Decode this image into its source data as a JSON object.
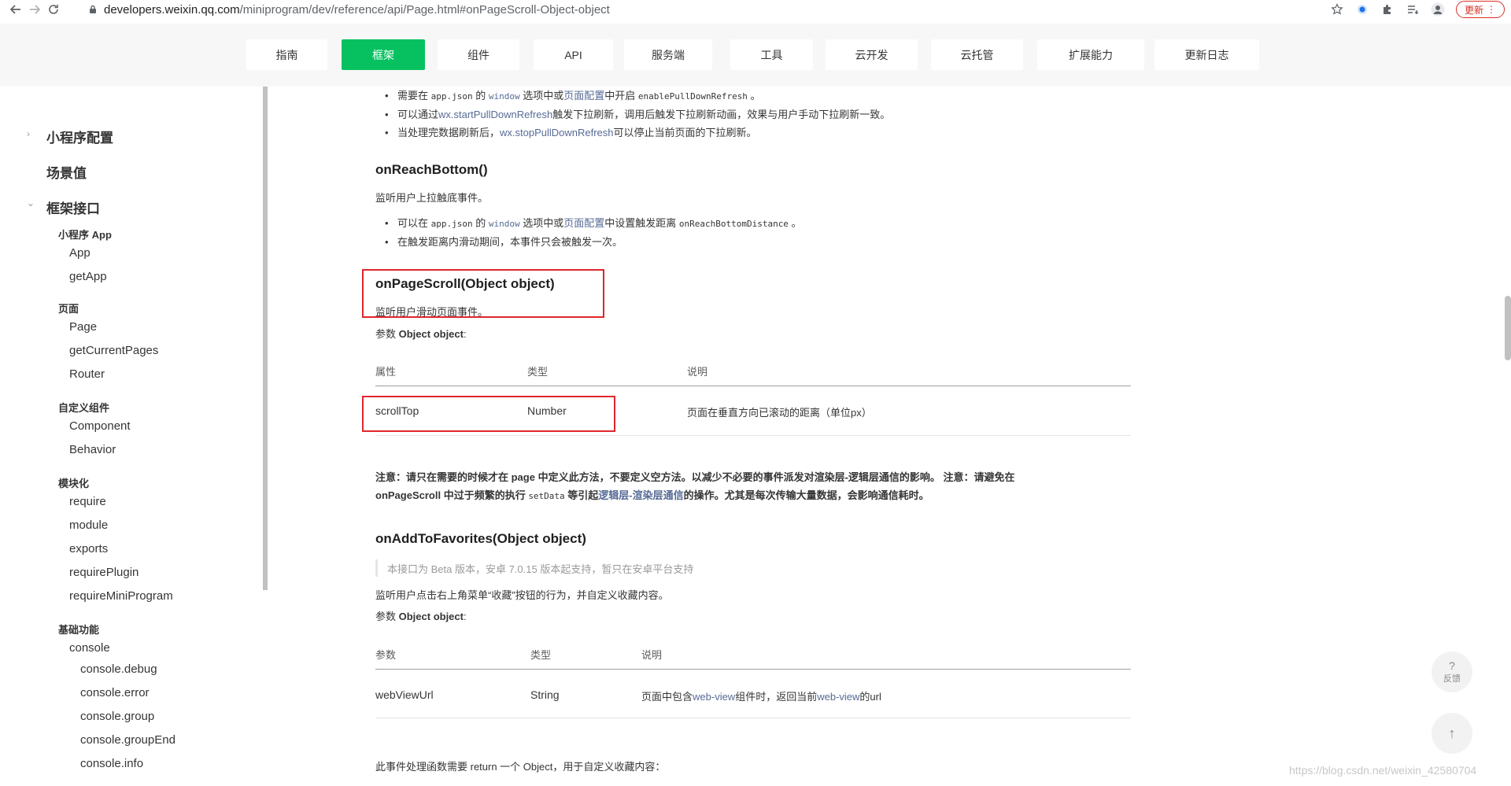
{
  "browser": {
    "url_host": "developers.weixin.qq.com",
    "url_path": "/miniprogram/dev/reference/api/Page.html#onPageScroll-Object-object",
    "update_label": "更新"
  },
  "topnav": {
    "tabs": [
      "指南",
      "框架",
      "组件",
      "API",
      "服务端",
      "工具",
      "云开发",
      "云托管",
      "扩展能力",
      "更新日志"
    ],
    "active_index": 1
  },
  "sidebar": {
    "item_config": "小程序配置",
    "item_scene": "场景值",
    "item_framework": "框架接口",
    "group_app": "小程序 App",
    "app": "App",
    "getApp": "getApp",
    "group_page": "页面",
    "page": "Page",
    "getCurrentPages": "getCurrentPages",
    "router": "Router",
    "group_component": "自定义组件",
    "component": "Component",
    "behavior": "Behavior",
    "group_module": "模块化",
    "require": "require",
    "module": "module",
    "exports": "exports",
    "requirePlugin": "requirePlugin",
    "requireMiniProgram": "requireMiniProgram",
    "group_basic": "基础功能",
    "console": "console",
    "console_debug": "console.debug",
    "console_error": "console.error",
    "console_group": "console.group",
    "console_groupEnd": "console.groupEnd",
    "console_info": "console.info"
  },
  "content": {
    "bullets_top": {
      "b1_pre": "需要在 ",
      "b1_code1": "app.json",
      "b1_mid1": " 的 ",
      "b1_code2": "window",
      "b1_mid2": " 选项中或",
      "b1_link": "页面配置",
      "b1_mid3": "中开启 ",
      "b1_code3": "enablePullDownRefresh",
      "b1_end": " 。",
      "b2_pre": "可以通过",
      "b2_link": "wx.startPullDownRefresh",
      "b2_end": "触发下拉刷新，调用后触发下拉刷新动画，效果与用户手动下拉刷新一致。",
      "b3_pre": "当处理完数据刷新后，",
      "b3_link": "wx.stopPullDownRefresh",
      "b3_end": "可以停止当前页面的下拉刷新。"
    },
    "reach_bottom": {
      "title": "onReachBottom()",
      "desc": "监听用户上拉触底事件。",
      "b1_pre": "可以在 ",
      "b1_code1": "app.json",
      "b1_mid1": " 的 ",
      "b1_code2": "window",
      "b1_mid2": " 选项中或",
      "b1_link": "页面配置",
      "b1_mid3": "中设置触发距离 ",
      "b1_code3": "onReachBottomDistance",
      "b1_end": " 。",
      "b2": "在触发距离内滑动期间，本事件只会被触发一次。"
    },
    "page_scroll": {
      "title": "onPageScroll(Object object)",
      "desc": "监听用户滑动页面事件。",
      "param_label_pre": "参数 ",
      "param_label_bold": "Object object",
      "param_label_end": ":",
      "table_headers": [
        "属性",
        "类型",
        "说明"
      ],
      "table_rows": [
        [
          "scrollTop",
          "Number",
          "页面在垂直方向已滚动的距离（单位px）"
        ]
      ],
      "note_line1": "注意：请只在需要的时候才在 page 中定义此方法，不要定义空方法。以减少不必要的事件派发对渲染层-逻辑层通信的影响。 注意：请避免在",
      "note_line2_pre": "onPageScroll 中过于频繁的执行 ",
      "note_line2_code": "setData",
      "note_line2_mid": " 等引起",
      "note_line2_link": "逻辑层-渲染层通信",
      "note_line2_end": "的操作。尤其是每次传输大量数据，会影响通信耗时。"
    },
    "favorites": {
      "title": "onAddToFavorites(Object object)",
      "quote": "本接口为 Beta 版本，安卓 7.0.15 版本起支持，暂只在安卓平台支持",
      "desc": "监听用户点击右上角菜单“收藏”按钮的行为，并自定义收藏内容。",
      "param_label_pre": "参数 ",
      "param_label_bold": "Object object",
      "param_label_end": ":",
      "table_headers": [
        "参数",
        "类型",
        "说明"
      ],
      "row_param": "webViewUrl",
      "row_type": "String",
      "row_desc_pre": "页面中包含",
      "row_desc_link1": "web-view",
      "row_desc_mid": "组件时，返回当前",
      "row_desc_link2": "web-view",
      "row_desc_end": "的url",
      "footer": "此事件处理函数需要 return 一个 Object，用于自定义收藏内容："
    }
  },
  "floating": {
    "feedback_symbol": "?",
    "feedback_label": "反馈",
    "top_symbol": "↑"
  },
  "watermark": "https://blog.csdn.net/weixin_42580704",
  "colors": {
    "accent_green": "#07c160",
    "link": "#576b95",
    "highlight_red": "#e0262d"
  }
}
